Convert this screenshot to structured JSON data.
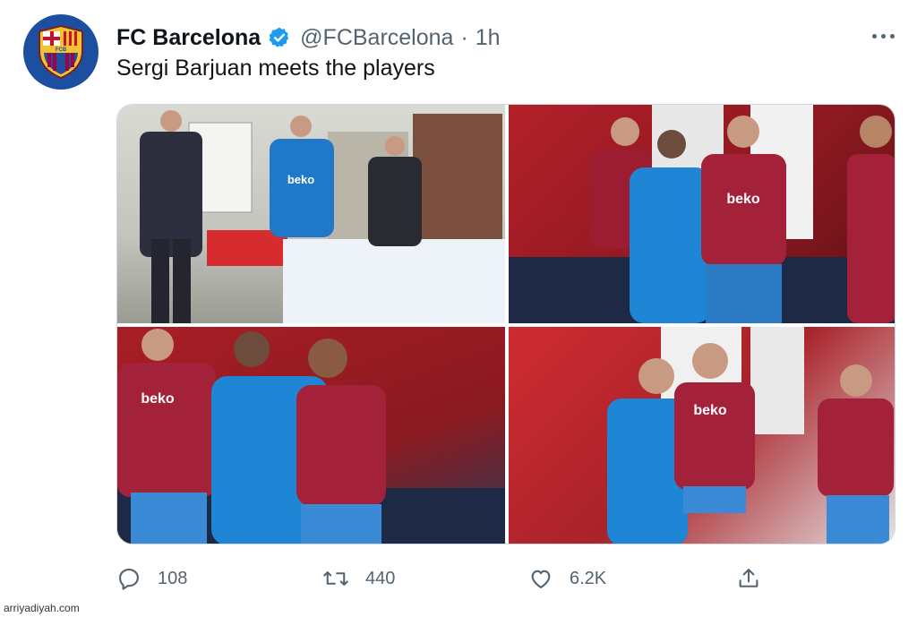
{
  "tweet": {
    "author_name": "FC Barcelona",
    "handle": "@FCBarcelona",
    "separator": "·",
    "time": "1h",
    "text": "Sergi Barjuan meets the players",
    "avatar_logo_text": "FCB",
    "verified_icon": "verified-badge-icon",
    "more_icon": "more-options-icon"
  },
  "media": {
    "photos": [
      {
        "jersey_text": "beko"
      },
      {
        "jersey_text": "beko"
      },
      {
        "jersey_text": "beko"
      },
      {
        "jersey_text": "beko"
      }
    ]
  },
  "actions": {
    "reply_count": "108",
    "retweet_count": "440",
    "like_count": "6.2K"
  },
  "watermark": "arriyadiyah.com",
  "colors": {
    "text_primary": "#0f1419",
    "text_secondary": "#536471",
    "verified": "#1d9bf0",
    "club_blue": "#1d4fa0",
    "club_red": "#a50044",
    "jersey_red": "#b32029"
  }
}
